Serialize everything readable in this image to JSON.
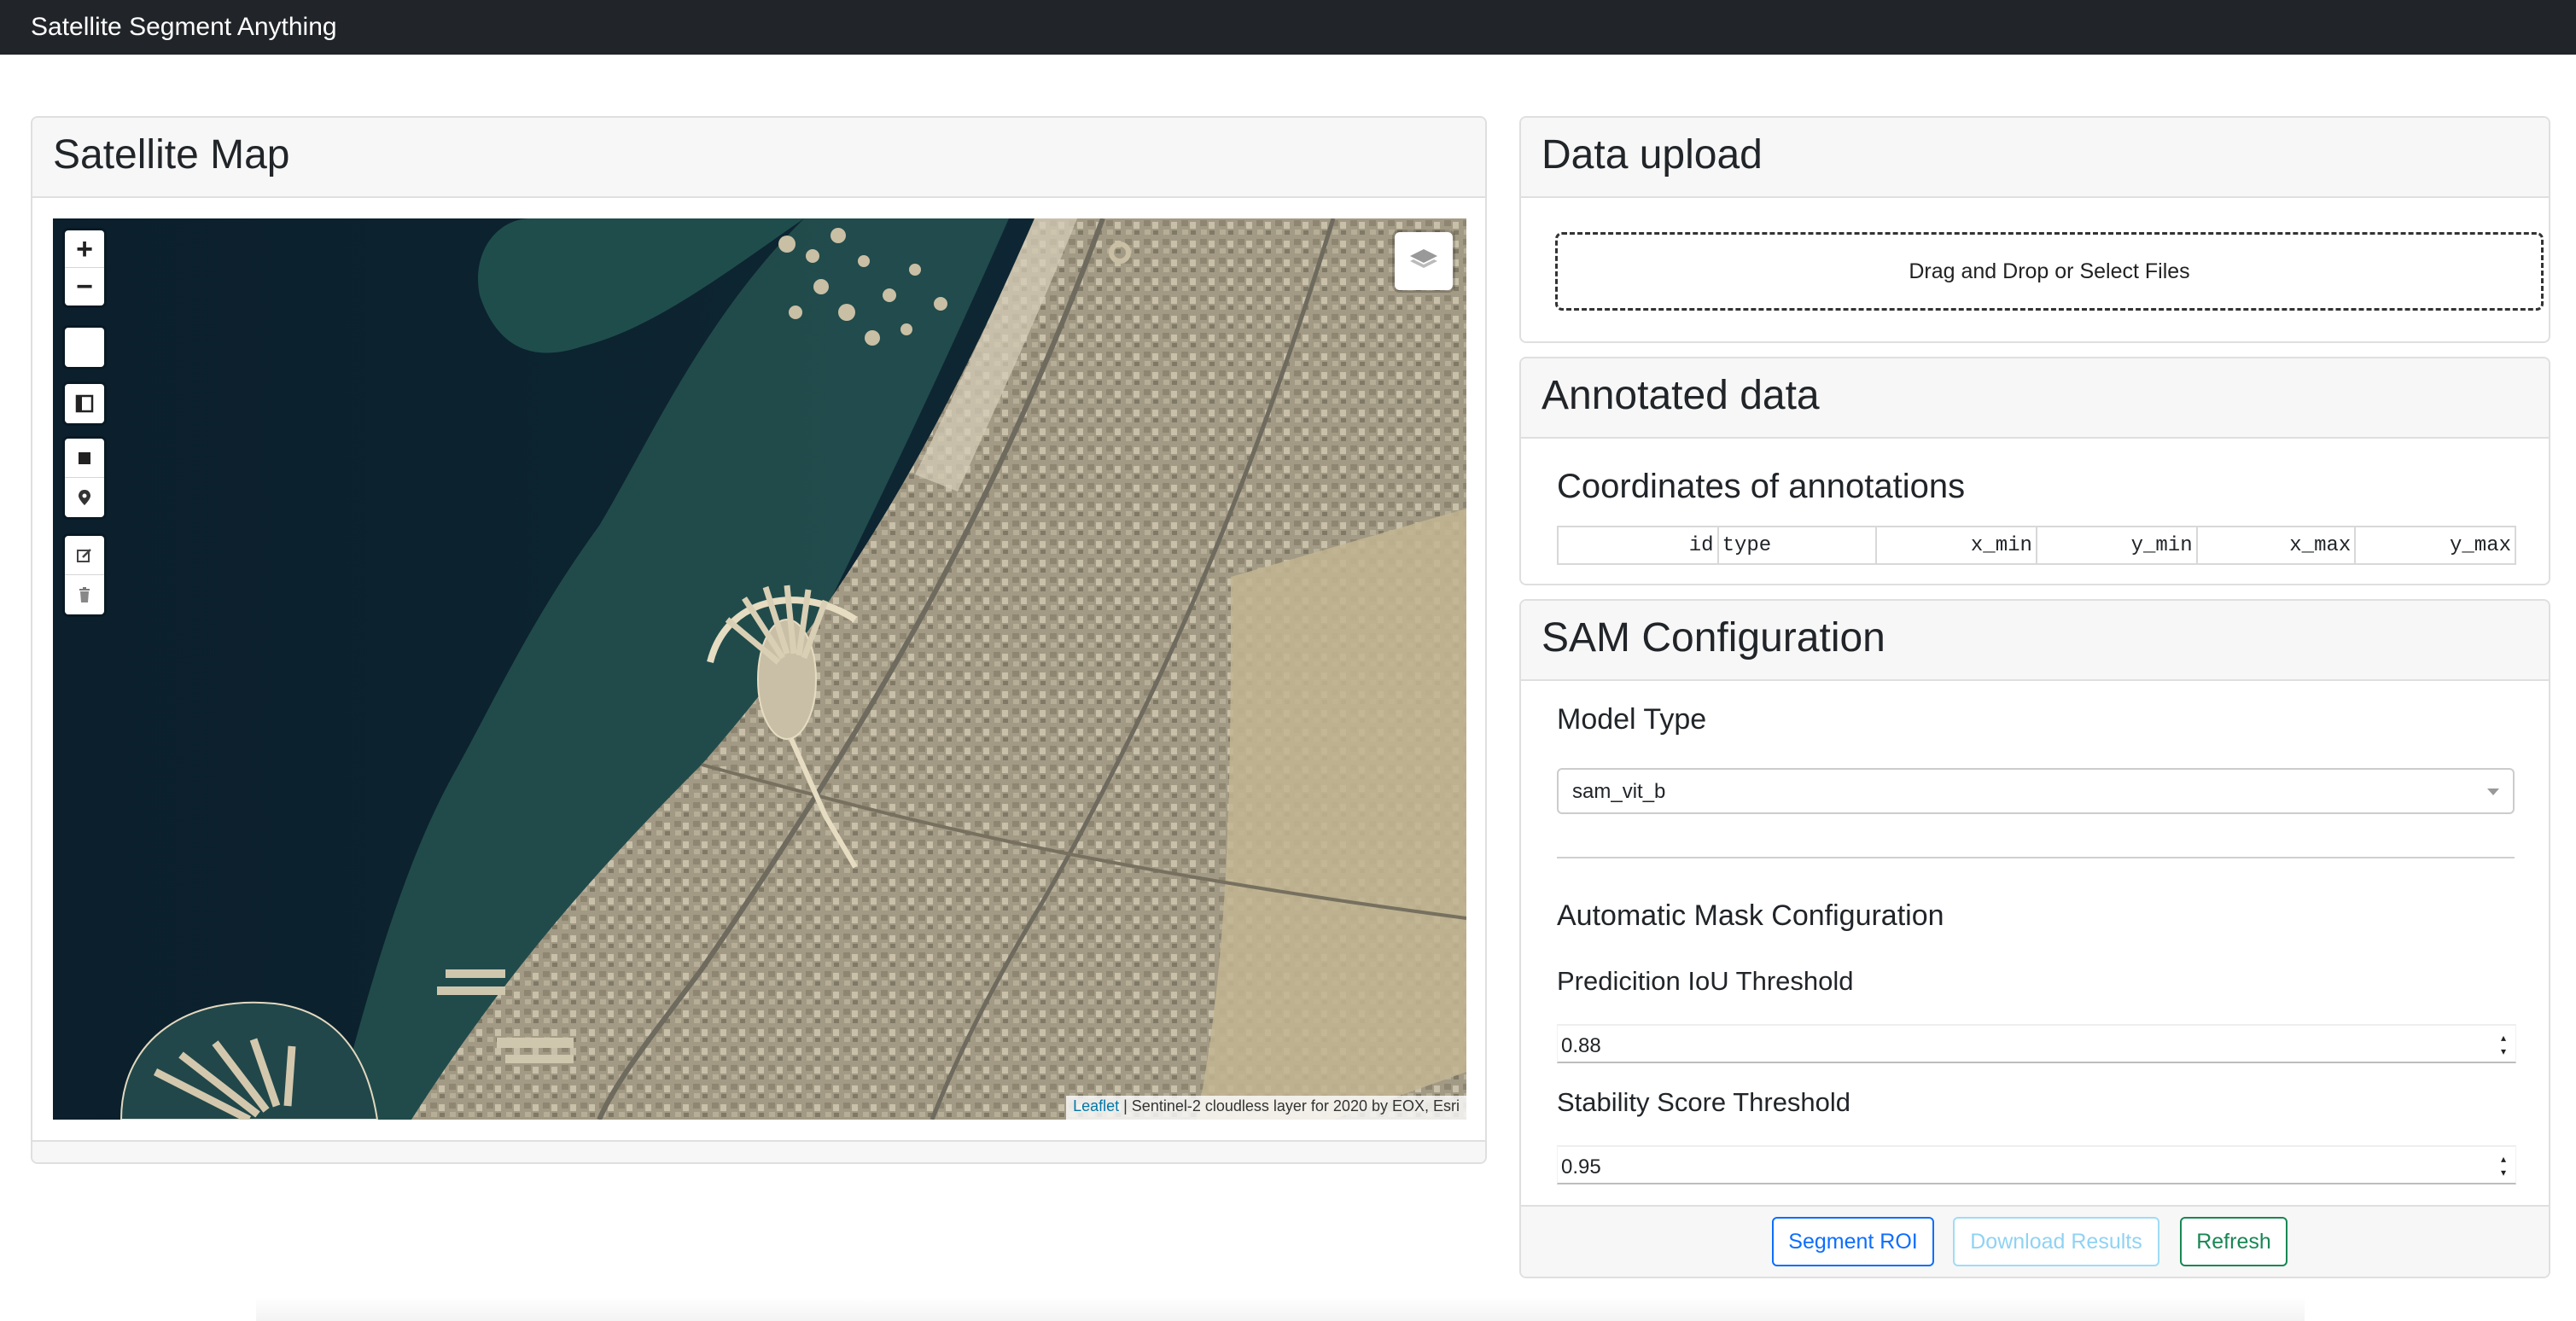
{
  "navbar": {
    "brand": "Satellite Segment Anything"
  },
  "map_card": {
    "title": "Satellite Map",
    "controls": {
      "zoom_in": "+",
      "zoom_out": "−"
    },
    "attribution_link": "Leaflet",
    "attribution_text": " | Sentinel-2 cloudless layer for 2020 by EOX, Esri"
  },
  "upload_card": {
    "title": "Data upload",
    "dropzone_text": "Drag and Drop or Select Files"
  },
  "annot_card": {
    "title": "Annotated data",
    "subtitle": "Coordinates of annotations",
    "columns": [
      "id",
      "type",
      "x_min",
      "y_min",
      "x_max",
      "y_max"
    ]
  },
  "sam_card": {
    "title": "SAM Configuration",
    "model_type_label": "Model Type",
    "model_type_value": "sam_vit_b",
    "auto_mask_label": "Automatic Mask Configuration",
    "iou_label": "Predicition IoU Threshold",
    "iou_value": "0.88",
    "stability_label": "Stability Score Threshold",
    "stability_value": "0.95",
    "buttons": {
      "segment": "Segment ROI",
      "download": "Download Results",
      "refresh": "Refresh"
    }
  },
  "colors": {
    "navbar": "#212529",
    "primary": "#0d6efd",
    "info": "#0dcaf0",
    "success": "#198754",
    "water": "#0d2230",
    "land": "#b5a98a"
  }
}
